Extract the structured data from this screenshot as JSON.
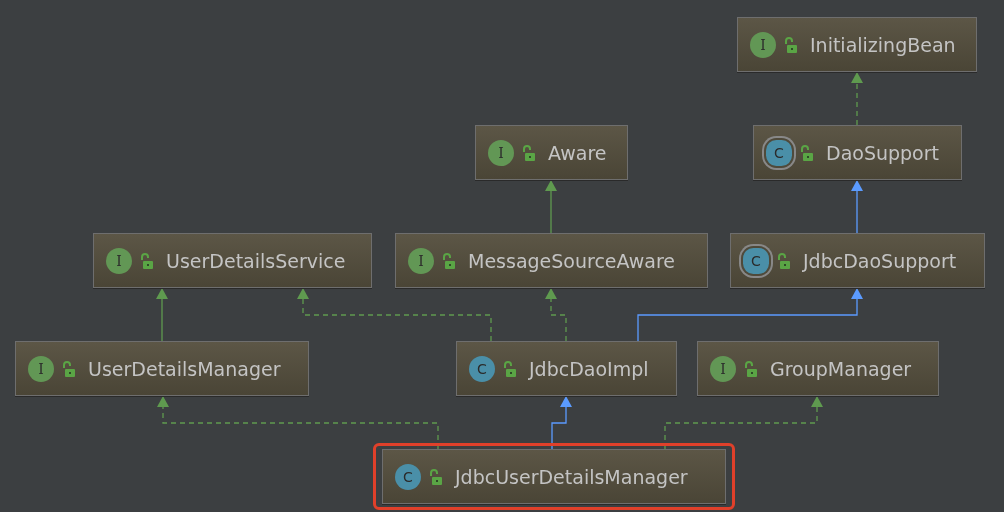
{
  "diagram": {
    "nodes": [
      {
        "name": "InitializingBean",
        "kind": "interface",
        "badge": "I",
        "selected": false
      },
      {
        "name": "Aware",
        "kind": "interface",
        "badge": "I",
        "selected": false
      },
      {
        "name": "DaoSupport",
        "kind": "abstract",
        "badge": "C",
        "selected": false
      },
      {
        "name": "UserDetailsService",
        "kind": "interface",
        "badge": "I",
        "selected": false
      },
      {
        "name": "MessageSourceAware",
        "kind": "interface",
        "badge": "I",
        "selected": false
      },
      {
        "name": "JdbcDaoSupport",
        "kind": "abstract",
        "badge": "C",
        "selected": false
      },
      {
        "name": "UserDetailsManager",
        "kind": "interface",
        "badge": "I",
        "selected": false
      },
      {
        "name": "JdbcDaoImpl",
        "kind": "class",
        "badge": "C",
        "selected": false
      },
      {
        "name": "GroupManager",
        "kind": "interface",
        "badge": "I",
        "selected": false
      },
      {
        "name": "JdbcUserDetailsManager",
        "kind": "class",
        "badge": "C",
        "selected": true
      }
    ],
    "edges": [
      {
        "kind": "implements"
      },
      {
        "kind": "extends"
      },
      {
        "kind": "interface-extends"
      },
      {
        "kind": "interface-extends"
      },
      {
        "kind": "implements"
      },
      {
        "kind": "implements"
      },
      {
        "kind": "extends"
      },
      {
        "kind": "implements"
      },
      {
        "kind": "extends"
      },
      {
        "kind": "implements"
      }
    ]
  }
}
